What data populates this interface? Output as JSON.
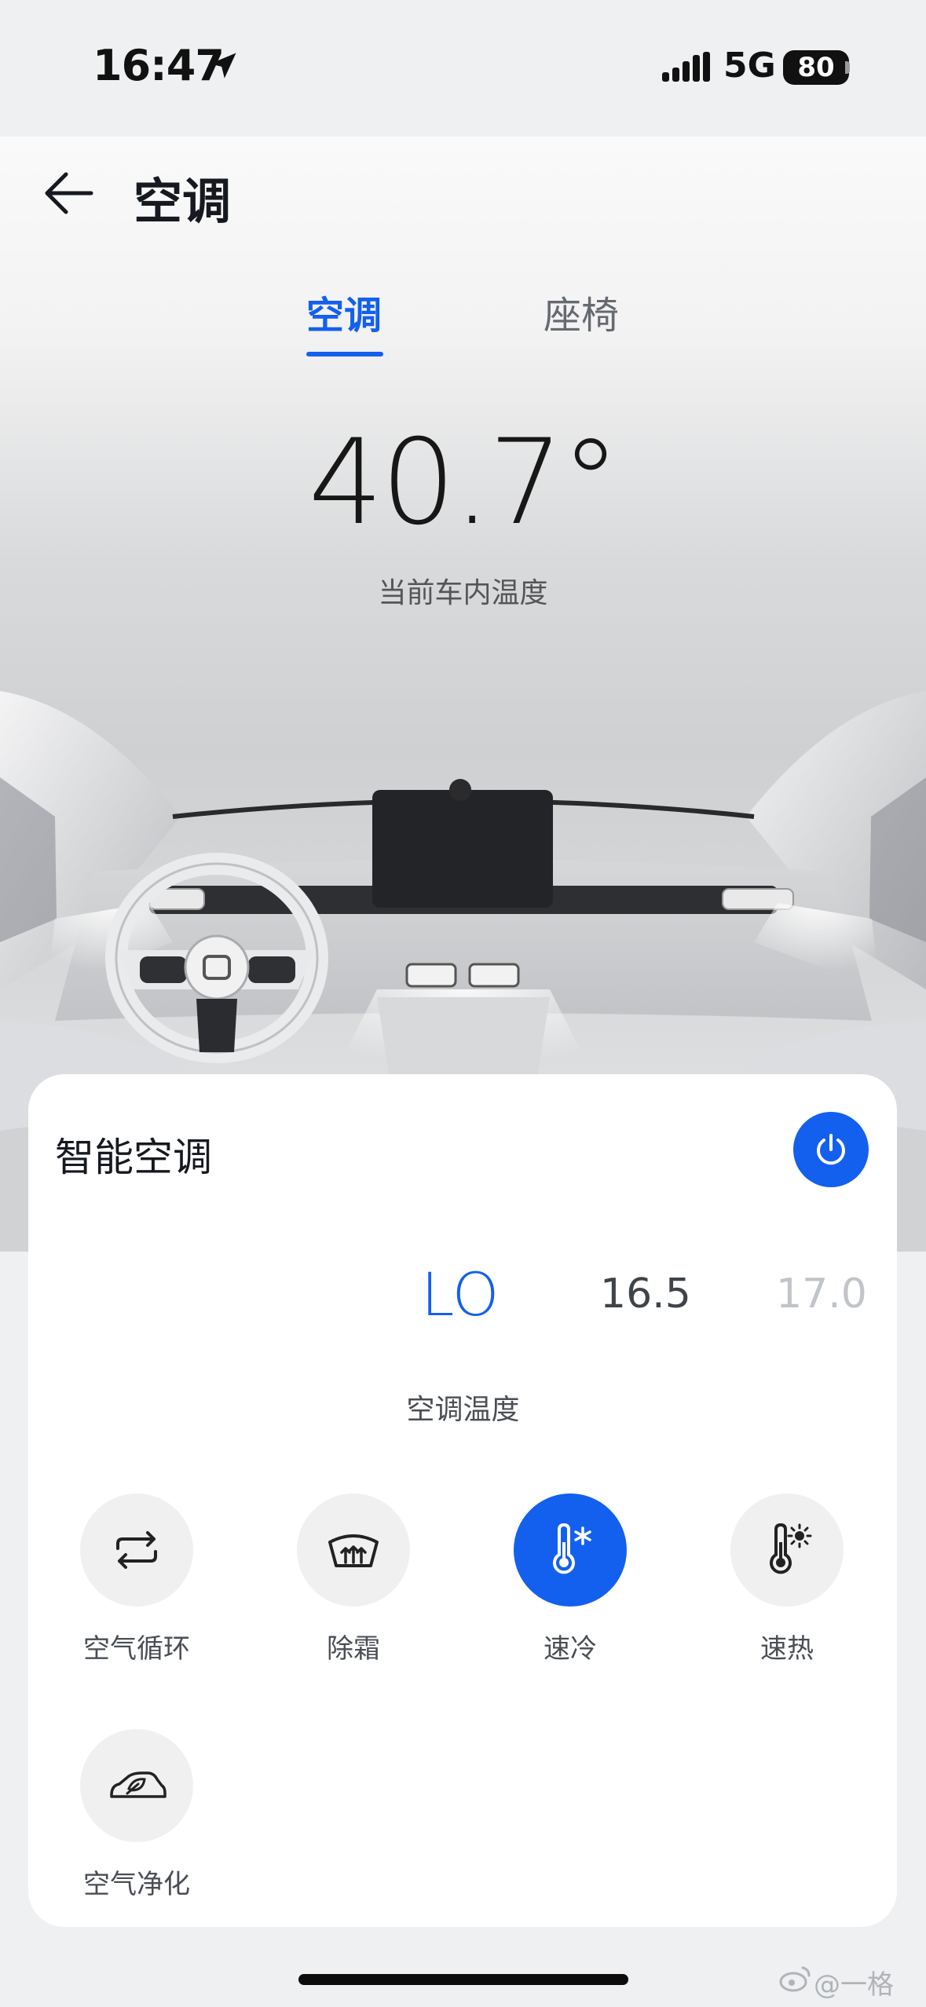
{
  "status_bar": {
    "time": "16:47",
    "network": "5G",
    "battery": "80"
  },
  "header": {
    "title": "空调"
  },
  "tabs": [
    {
      "label": "空调",
      "active": true
    },
    {
      "label": "座椅",
      "active": false
    }
  ],
  "cabin": {
    "temperature": "40.7°",
    "temperature_label": "当前车内温度"
  },
  "panel": {
    "title": "智能空调",
    "power_on": true,
    "temperature_options": [
      "LO",
      "16.5",
      "17.0"
    ],
    "selected_temperature": "LO",
    "temperature_label": "空调温度",
    "functions": [
      {
        "label": "空气循环",
        "icon": "air-circulation-icon",
        "active": false
      },
      {
        "label": "除霜",
        "icon": "defrost-icon",
        "active": false
      },
      {
        "label": "速冷",
        "icon": "quick-cool-icon",
        "active": true
      },
      {
        "label": "速热",
        "icon": "quick-heat-icon",
        "active": false
      },
      {
        "label": "空气净化",
        "icon": "air-purify-icon",
        "active": false
      }
    ]
  },
  "watermark": "@一格",
  "colors": {
    "accent": "#1360ee",
    "background": "#eef0f2",
    "panel": "#ffffff"
  }
}
